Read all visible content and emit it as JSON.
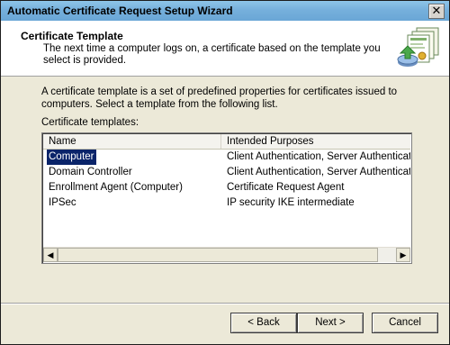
{
  "window": {
    "title": "Automatic Certificate Request Setup Wizard",
    "close_glyph": "✕"
  },
  "header": {
    "title": "Certificate Template",
    "subtitle": "The next time a computer logs on, a certificate based on the template you select is provided."
  },
  "content": {
    "description": "A certificate template is a set of predefined properties for certificates issued to computers. Select a template from the following list.",
    "list_label": "Certificate templates:",
    "columns": [
      "Name",
      "Intended Purposes"
    ],
    "rows": [
      {
        "name": "Computer",
        "purposes": "Client Authentication, Server Authentication"
      },
      {
        "name": "Domain Controller",
        "purposes": "Client Authentication, Server Authentication"
      },
      {
        "name": "Enrollment Agent (Computer)",
        "purposes": "Certificate Request Agent"
      },
      {
        "name": "IPSec",
        "purposes": "IP security IKE intermediate"
      }
    ],
    "selected_row": 0
  },
  "buttons": {
    "back": "< Back",
    "next": "Next >",
    "cancel": "Cancel"
  }
}
